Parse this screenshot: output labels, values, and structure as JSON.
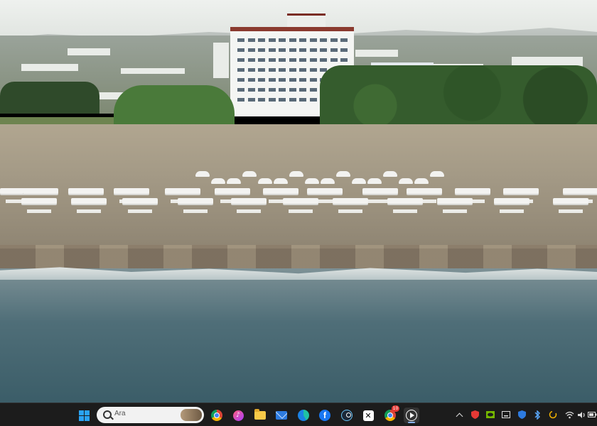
{
  "desktop": {
    "wallpaper": "beach-resort-aerial-photo"
  },
  "taskbar": {
    "start": {
      "icon": "windows-start-icon"
    },
    "search": {
      "placeholder": "Ara",
      "icon": "search-icon"
    },
    "apps": [
      {
        "name": "chrome",
        "icon": "chrome-icon"
      },
      {
        "name": "music",
        "icon": "music-icon"
      },
      {
        "name": "file-explorer",
        "icon": "folder-icon"
      },
      {
        "name": "mail",
        "icon": "mail-icon"
      },
      {
        "name": "edge",
        "icon": "edge-icon"
      },
      {
        "name": "facebook",
        "icon": "facebook-icon",
        "glyph": "f"
      },
      {
        "name": "steam",
        "icon": "steam-icon"
      },
      {
        "name": "capcut",
        "icon": "capcut-icon",
        "glyph": "✕"
      },
      {
        "name": "chrome-profile",
        "icon": "chrome-icon",
        "badge": "10"
      },
      {
        "name": "media-player",
        "icon": "play-icon",
        "active": true
      }
    ],
    "tray": [
      "chevron-up-icon",
      "shield-red-icon",
      "nvidia-icon",
      "keyboard-icon",
      "defender-icon",
      "bluetooth-icon",
      "sync-icon",
      "wifi-icon",
      "volume-icon",
      "battery-icon"
    ]
  },
  "colors": {
    "taskbar_bg": "#1c1c1c",
    "accent": "#8ab4f8",
    "badge": "#e53935"
  }
}
